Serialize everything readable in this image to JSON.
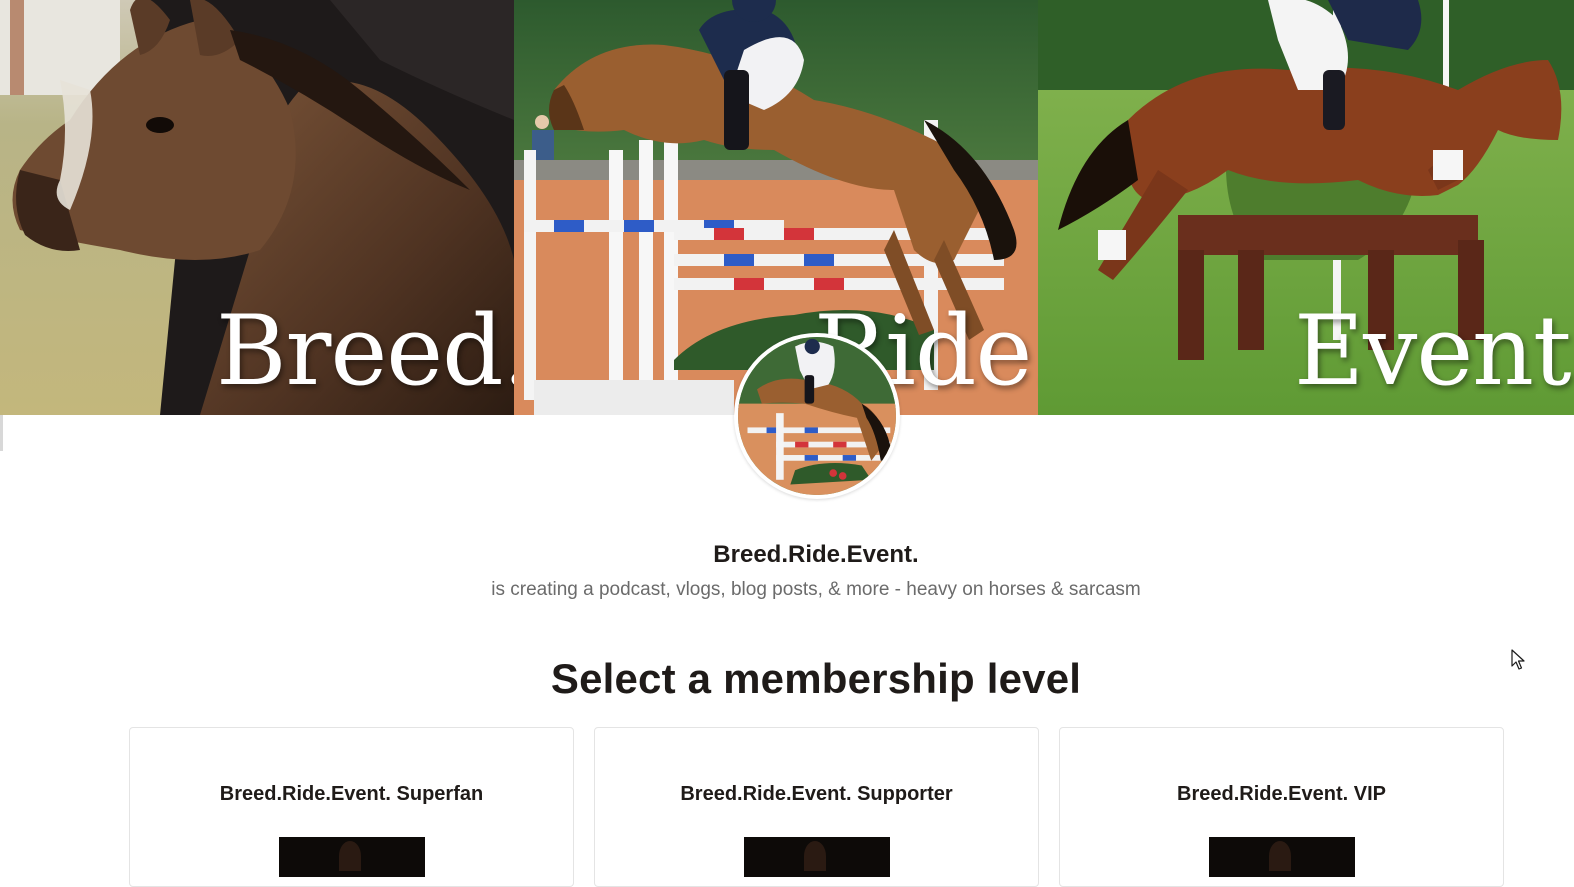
{
  "banner": {
    "word_breed": "Breed.",
    "word_ride": "Ride.",
    "word_event": "Event."
  },
  "creator": {
    "name": "Breed.Ride.Event.",
    "tagline": "is creating a podcast, vlogs, blog posts, & more - heavy on horses & sarcasm"
  },
  "membership": {
    "heading": "Select a membership level",
    "tiers": [
      {
        "title": "Breed.Ride.Event. Superfan"
      },
      {
        "title": "Breed.Ride.Event. Supporter"
      },
      {
        "title": "Breed.Ride.Event. VIP"
      }
    ]
  },
  "icons": {
    "cursor": "arrow-cursor-icon"
  }
}
